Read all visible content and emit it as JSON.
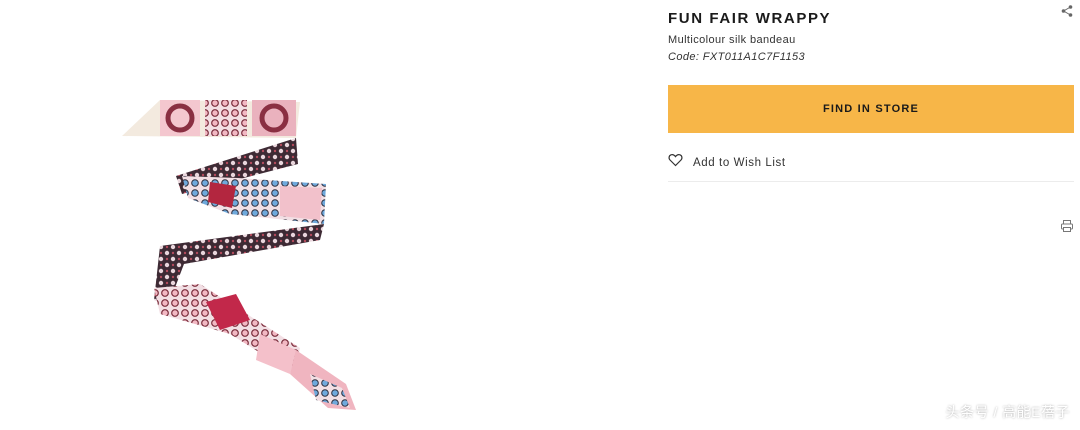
{
  "product": {
    "title": "FUN FAIR WRAPPY",
    "subtitle": "Multicolour silk bandeau",
    "code": "Code: FXT011A1C7F1153"
  },
  "actions": {
    "find_in_store": "FIND IN STORE",
    "wish_list": "Add to Wish List"
  },
  "icons": {
    "share": "share-icon",
    "heart": "heart-icon",
    "print": "print-icon"
  },
  "colors": {
    "accent": "#f7b648",
    "text": "#1a1a1a"
  },
  "watermark": "头条号 / 高能E蓓子"
}
